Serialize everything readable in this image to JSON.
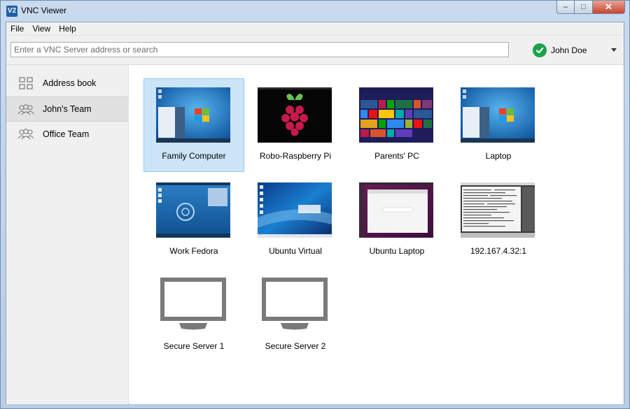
{
  "window": {
    "title": "VNC Viewer",
    "icon_text": "V2",
    "buttons": {
      "minimize": "–",
      "maximize": "□",
      "close": "✕"
    }
  },
  "menu": [
    {
      "label": "File"
    },
    {
      "label": "View"
    },
    {
      "label": "Help"
    }
  ],
  "search": {
    "placeholder": "Enter a VNC Server address or search",
    "value": ""
  },
  "user": {
    "name": "John Doe",
    "status_icon": "check-icon",
    "status_color": "#1aa34a"
  },
  "sidebar": {
    "items": [
      {
        "label": "Address book",
        "icon": "grid-icon",
        "active": false
      },
      {
        "label": "John's Team",
        "icon": "team-icon",
        "active": true
      },
      {
        "label": "Office Team",
        "icon": "team-icon",
        "active": false
      }
    ]
  },
  "computers": [
    {
      "label": "Family Computer",
      "thumb": "windows7",
      "selected": true
    },
    {
      "label": "Robo-Raspberry Pi",
      "thumb": "raspberry",
      "selected": false
    },
    {
      "label": "Parents' PC",
      "thumb": "windows8",
      "selected": false
    },
    {
      "label": "Laptop",
      "thumb": "windows7",
      "selected": false
    },
    {
      "label": "Work Fedora",
      "thumb": "fedora",
      "selected": false
    },
    {
      "label": "Ubuntu Virtual",
      "thumb": "kde",
      "selected": false
    },
    {
      "label": "Ubuntu Laptop",
      "thumb": "ubuntu",
      "selected": false
    },
    {
      "label": "192.167.4.32:1",
      "thumb": "terminal",
      "selected": false
    },
    {
      "label": "Secure Server 1",
      "thumb": "monitor",
      "selected": false
    },
    {
      "label": "Secure Server 2",
      "thumb": "monitor",
      "selected": false
    }
  ],
  "colors": {
    "selection": "#cce4f7",
    "accent": "#1f5fa8"
  }
}
